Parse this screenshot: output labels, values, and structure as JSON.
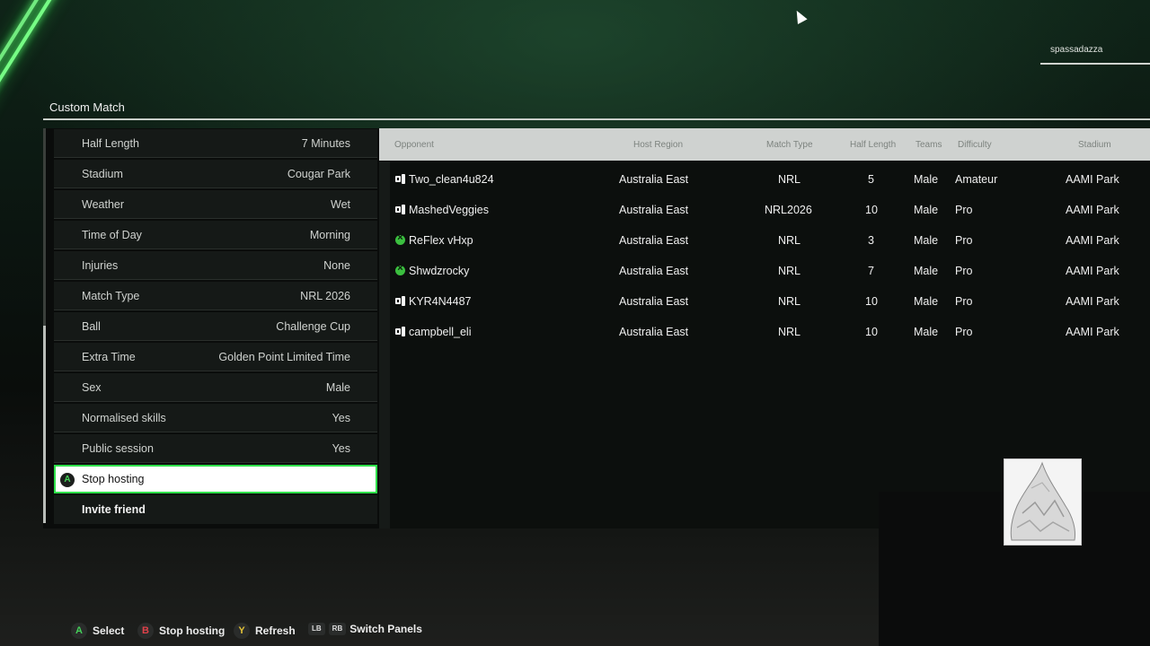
{
  "header": {
    "username": "spassadazza",
    "title": "Custom Match"
  },
  "settings": [
    {
      "label": "Half Length",
      "value": "7 Minutes"
    },
    {
      "label": "Stadium",
      "value": "Cougar Park"
    },
    {
      "label": "Weather",
      "value": "Wet"
    },
    {
      "label": "Time of Day",
      "value": "Morning"
    },
    {
      "label": "Injuries",
      "value": "None"
    },
    {
      "label": "Match Type",
      "value": "NRL 2026"
    },
    {
      "label": "Ball",
      "value": "Challenge Cup"
    },
    {
      "label": "Extra Time",
      "value": "Golden Point Limited Time"
    },
    {
      "label": "Sex",
      "value": "Male"
    },
    {
      "label": "Normalised skills",
      "value": "Yes"
    },
    {
      "label": "Public session",
      "value": "Yes"
    }
  ],
  "actions": [
    {
      "label": "Stop hosting",
      "button": "A",
      "selected": true
    },
    {
      "label": "Invite friend",
      "selected": false
    }
  ],
  "table": {
    "columns": [
      "Opponent",
      "Host Region",
      "Match Type",
      "Half Length",
      "Teams",
      "Difficulty",
      "Stadium"
    ],
    "rows": [
      {
        "platform": "pc-icon",
        "opponent": "Two_clean4u824",
        "region": "Australia East",
        "match_type": "NRL",
        "half_length": "5",
        "teams": "Male",
        "difficulty": "Amateur",
        "stadium": "AAMI Park"
      },
      {
        "platform": "pc-icon",
        "opponent": "MashedVeggies",
        "region": "Australia East",
        "match_type": "NRL2026",
        "half_length": "10",
        "teams": "Male",
        "difficulty": "Pro",
        "stadium": "AAMI Park"
      },
      {
        "platform": "xbox-icon",
        "opponent": "ReFlex vHxp",
        "region": "Australia East",
        "match_type": "NRL",
        "half_length": "3",
        "teams": "Male",
        "difficulty": "Pro",
        "stadium": "AAMI Park"
      },
      {
        "platform": "xbox-icon",
        "opponent": "Shwdzrocky",
        "region": "Australia East",
        "match_type": "NRL",
        "half_length": "7",
        "teams": "Male",
        "difficulty": "Pro",
        "stadium": "AAMI Park"
      },
      {
        "platform": "pc-icon",
        "opponent": "KYR4N4487",
        "region": "Australia East",
        "match_type": "NRL",
        "half_length": "10",
        "teams": "Male",
        "difficulty": "Pro",
        "stadium": "AAMI Park"
      },
      {
        "platform": "pc-icon",
        "opponent": "campbell_eli",
        "region": "Australia East",
        "match_type": "NRL",
        "half_length": "10",
        "teams": "Male",
        "difficulty": "Pro",
        "stadium": "AAMI Park"
      }
    ]
  },
  "prompts": [
    {
      "button": "A",
      "label": "Select"
    },
    {
      "button": "B",
      "label": "Stop hosting"
    },
    {
      "button": "Y",
      "label": "Refresh"
    },
    {
      "buttons": [
        "LB",
        "RB"
      ],
      "label": "Switch Panels"
    }
  ],
  "colors": {
    "accent": "#2ee04a",
    "neon": "#7cff8a",
    "header_bg": "#cfd2d0"
  }
}
